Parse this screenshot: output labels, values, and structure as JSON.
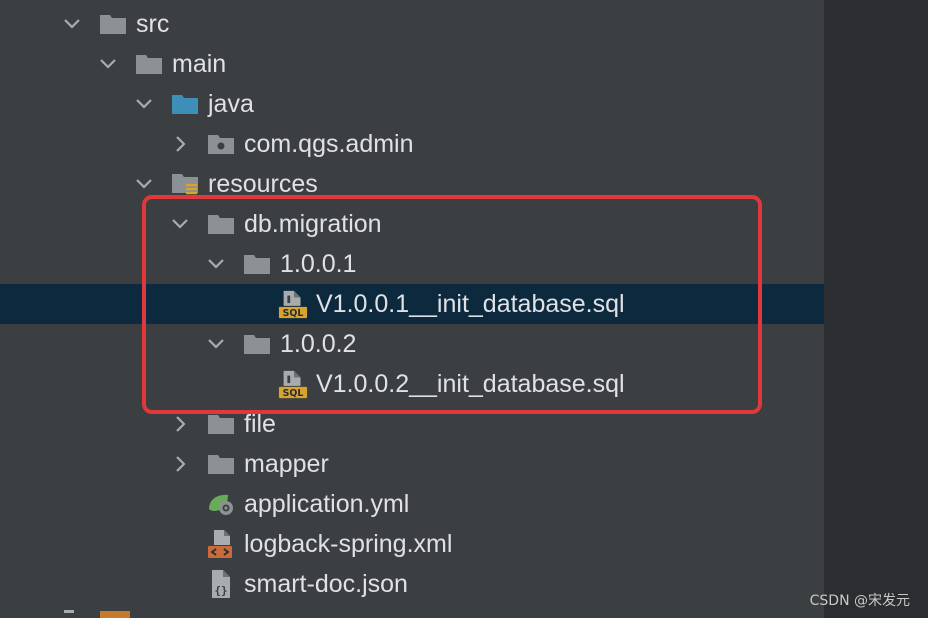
{
  "tree": {
    "rows": [
      {
        "label": "src",
        "expand": "open",
        "icon": "folder-icon"
      },
      {
        "label": "main",
        "expand": "open",
        "icon": "folder-icon"
      },
      {
        "label": "java",
        "expand": "open",
        "icon": "source-folder-icon"
      },
      {
        "label": "com.qgs.admin",
        "expand": "closed",
        "icon": "package-icon"
      },
      {
        "label": "resources",
        "expand": "open",
        "icon": "resources-folder-icon"
      },
      {
        "label": "db.migration",
        "expand": "open",
        "icon": "folder-icon"
      },
      {
        "label": "1.0.0.1",
        "expand": "open",
        "icon": "folder-icon"
      },
      {
        "label": "V1.0.0.1__init_database.sql",
        "expand": "none",
        "icon": "sql-file-icon",
        "selected": true
      },
      {
        "label": "1.0.0.2",
        "expand": "open",
        "icon": "folder-icon"
      },
      {
        "label": "V1.0.0.2__init_database.sql",
        "expand": "none",
        "icon": "sql-file-icon"
      },
      {
        "label": "file",
        "expand": "closed",
        "icon": "folder-icon"
      },
      {
        "label": "mapper",
        "expand": "closed",
        "icon": "folder-icon"
      },
      {
        "label": "application.yml",
        "expand": "none",
        "icon": "spring-yml-file-icon"
      },
      {
        "label": "logback-spring.xml",
        "expand": "none",
        "icon": "xml-file-icon"
      },
      {
        "label": "smart-doc.json",
        "expand": "none",
        "icon": "json-file-icon"
      }
    ]
  },
  "watermark": "CSDN @宋发元",
  "colors": {
    "panel_bg": "#3c3f41",
    "selection_bg": "#0d293e",
    "text": "#dfe1e5",
    "folder": "#8c9196",
    "source_folder": "#3d8fb7",
    "sql_badge": "#d9a42e",
    "annotation": "#e0383b"
  }
}
